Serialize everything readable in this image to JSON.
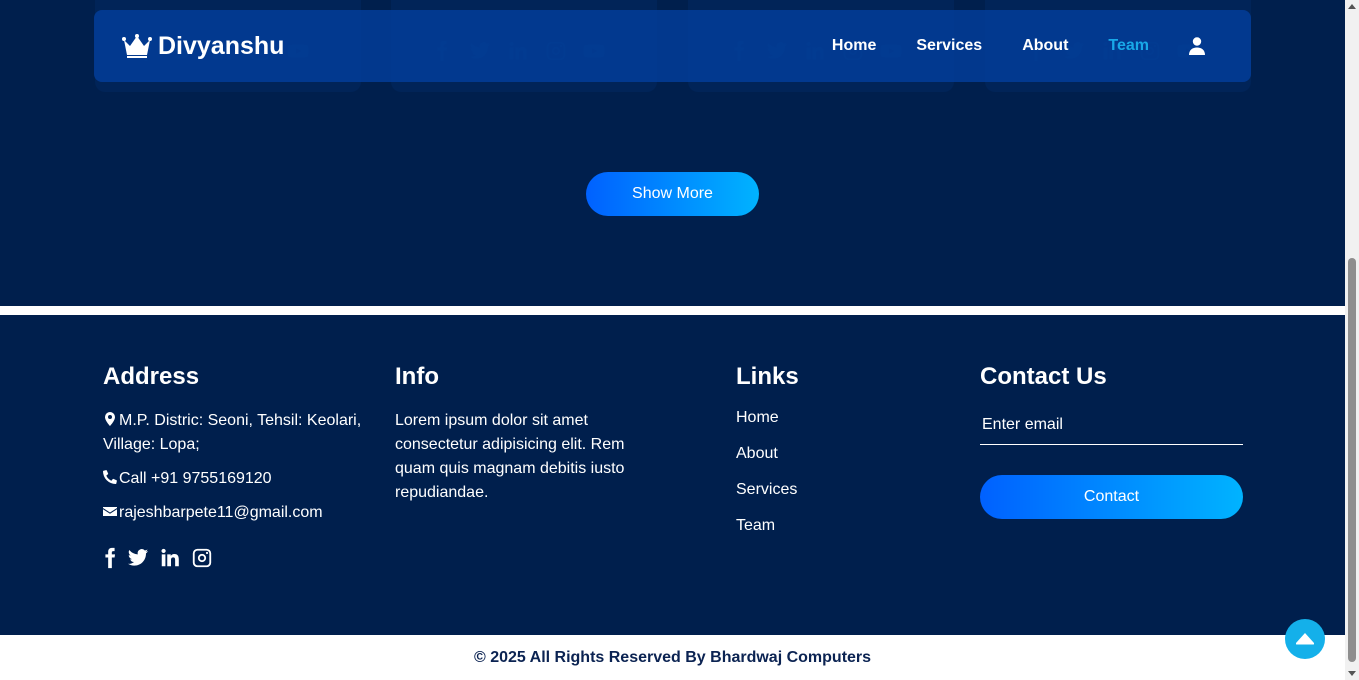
{
  "navbar": {
    "brand": "Divyanshu",
    "links": [
      "Home",
      "Services",
      "About",
      "Team"
    ],
    "active": "Team"
  },
  "team": {
    "show_more_label": "Show More"
  },
  "footer": {
    "address": {
      "title": "Address",
      "location": "M.P. Distric: Seoni, Tehsil: Keolari, Village: Lopa;",
      "phone": "Call +91 9755169120",
      "email": "rajeshbarpete11@gmail.com"
    },
    "info": {
      "title": "Info",
      "text": "Lorem ipsum dolor sit amet consectetur adipisicing elit. Rem quam quis magnam debitis iusto repudiandae."
    },
    "links": {
      "title": "Links",
      "items": [
        "Home",
        "About",
        "Services",
        "Team"
      ]
    },
    "contact": {
      "title": "Contact Us",
      "email_placeholder": "Enter email",
      "button_label": "Contact"
    },
    "copyright": "© 2025 All Rights Reserved By Bhardwaj Computers"
  },
  "icons": {
    "brand": "crown-icon",
    "user": "user-icon",
    "scroll_top": "caret-up-icon",
    "socials": [
      "facebook-icon",
      "twitter-icon",
      "linkedin-icon",
      "instagram-icon",
      "youtube-icon"
    ]
  },
  "colors": {
    "background": "#001f4d",
    "navbar": "#023c96",
    "accent_active": "#18a8e8",
    "button_gradient_start": "#0061ff",
    "button_gradient_end": "#00b3ff"
  }
}
